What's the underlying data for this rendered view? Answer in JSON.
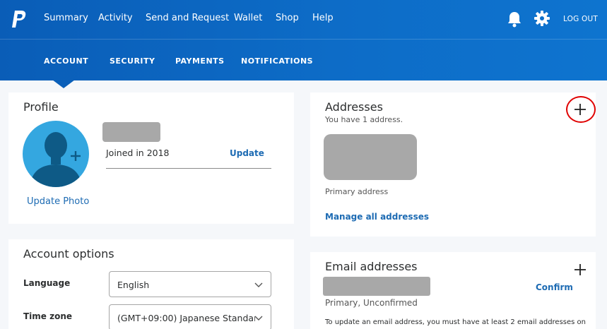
{
  "header": {
    "nav": [
      "Summary",
      "Activity",
      "Send and Request",
      "Wallet",
      "Shop",
      "Help"
    ],
    "logout": "LOG OUT",
    "subnav": [
      "ACCOUNT",
      "SECURITY",
      "PAYMENTS",
      "NOTIFICATIONS"
    ]
  },
  "profile": {
    "title": "Profile",
    "joined": "Joined in 2018",
    "update": "Update",
    "update_photo": "Update Photo"
  },
  "account_options": {
    "title": "Account options",
    "language_label": "Language",
    "language_value": "English",
    "timezone_label": "Time zone",
    "timezone_value": "(GMT+09:00) Japanese Standar..."
  },
  "addresses": {
    "title": "Addresses",
    "count_text": "You have 1 address.",
    "primary": "Primary address",
    "manage": "Manage all addresses"
  },
  "email": {
    "title": "Email addresses",
    "status": "Primary, Unconfirmed",
    "confirm": "Confirm",
    "note": "To update an email address, you must have at least 2 email addresses on"
  },
  "colors": {
    "header_blue": "#0a5db7",
    "link_blue": "#1d6bb3",
    "avatar_blue": "#34a7e0",
    "highlight_red": "#e00000"
  }
}
